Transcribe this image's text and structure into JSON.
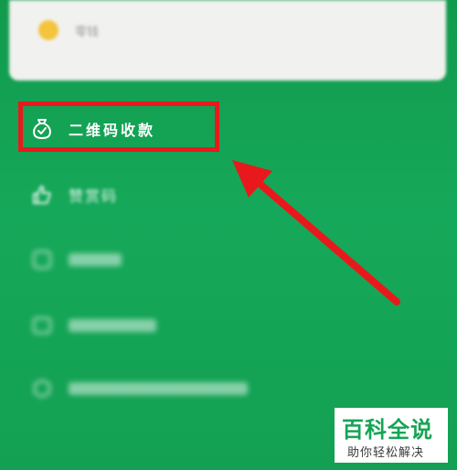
{
  "top_card": {
    "label": "零钱"
  },
  "menu": {
    "qr_receive": {
      "label": "二维码收款",
      "icon": "money-bag-icon"
    },
    "reward_code": {
      "label": "赞赏码",
      "icon": "thumbs-up-icon"
    }
  },
  "annotation": {
    "color": "#e8191c"
  },
  "watermark": {
    "title": "百科全说",
    "subtitle": "助你轻松解决"
  },
  "colors": {
    "background": "#16a455",
    "accent": "#e8191c"
  }
}
